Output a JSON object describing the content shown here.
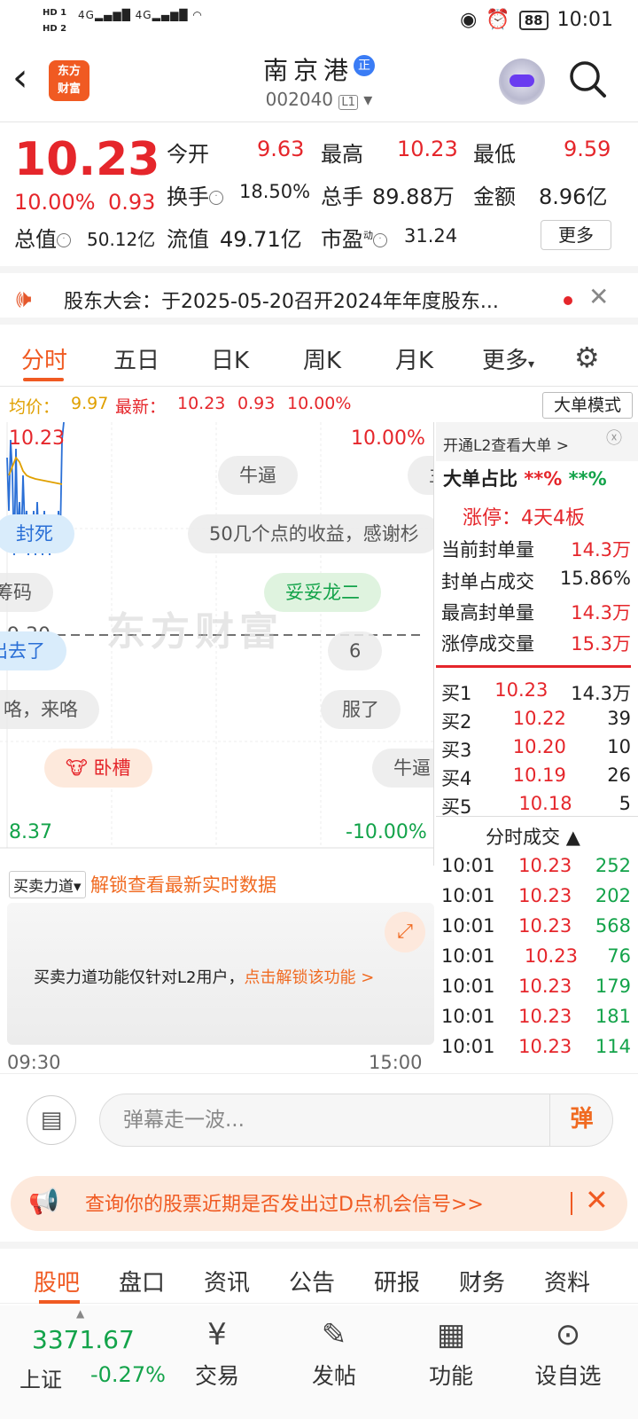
{
  "status_bar": {
    "hd1": "HD 1",
    "hd2": "HD 2",
    "net1": "4G",
    "net2": "4G",
    "battery": "88",
    "time": "10:01"
  },
  "header": {
    "logo_line1": "东方",
    "logo_line2": "财富",
    "stock_name": "南京港",
    "stock_badge": "正",
    "stock_code": "002040",
    "level": "L1"
  },
  "quote": {
    "price": "10.23",
    "change_pct": "10.00%",
    "change_amt": "0.93",
    "open_label": "今开",
    "open": "9.63",
    "high_label": "最高",
    "high": "10.23",
    "low_label": "最低",
    "low": "9.59",
    "turnover_label": "换手",
    "turnover": "18.50%",
    "volume_label": "总手",
    "volume": "89.88万",
    "amount_label": "金额",
    "amount": "8.96亿",
    "total_cap_label": "总值",
    "total_cap": "50.12亿",
    "float_cap_label": "流值",
    "float_cap": "49.71亿",
    "pe_label": "市盈",
    "pe_sup": "动",
    "pe": "31.24",
    "more": "更多"
  },
  "notice": {
    "text": "股东大会：于2025-05-20召开2024年年度股东..."
  },
  "tabs": [
    "分时",
    "五日",
    "日K",
    "周K",
    "月K",
    "更多"
  ],
  "chart_head": {
    "avg_label": "均价：",
    "avg": "9.97",
    "latest_label": "最新：",
    "latest": "10.23",
    "chg": "0.93",
    "pct": "10.00%",
    "mode_btn": "大单模式"
  },
  "chart": {
    "top_price": "10.23",
    "top_pct": "10.00%",
    "mid_price": "9.30",
    "bottom_price": "8.37",
    "bottom_pct": "-10.00%",
    "watermark": "东方财富"
  },
  "danmu": [
    "牛逼",
    "50几个点的收益，感谢杉",
    "封死",
    "筹码",
    "妥妥龙二",
    "出去了",
    "6",
    "咯，来咯",
    "服了",
    "卧槽",
    "牛逼"
  ],
  "side": {
    "l2_link": "开通L2查看大单 >",
    "big_ratio_label": "大单占比",
    "big_ratio_red": "**%",
    "big_ratio_green": "**%",
    "limit_up": "涨停：4天4板",
    "rows": [
      {
        "label": "当前封单量",
        "value": "14.3万"
      },
      {
        "label": "封单占成交",
        "value": "15.86%"
      },
      {
        "label": "最高封单量",
        "value": "14.3万"
      },
      {
        "label": "涨停成交量",
        "value": "15.3万"
      }
    ],
    "bids": [
      {
        "label": "买1",
        "price": "10.23",
        "vol": "14.3万"
      },
      {
        "label": "买2",
        "price": "10.22",
        "vol": "39"
      },
      {
        "label": "买3",
        "price": "10.20",
        "vol": "10"
      },
      {
        "label": "买4",
        "price": "10.19",
        "vol": "26"
      },
      {
        "label": "买5",
        "price": "10.18",
        "vol": "5"
      }
    ],
    "ticks_title": "分时成交",
    "ticks": [
      {
        "time": "10:01",
        "price": "10.23",
        "vol": "252"
      },
      {
        "time": "10:01",
        "price": "10.23",
        "vol": "202"
      },
      {
        "time": "10:01",
        "price": "10.23",
        "vol": "568"
      },
      {
        "time": "10:01",
        "price": "10.23",
        "vol": "76"
      },
      {
        "time": "10:01",
        "price": "10.23",
        "vol": "179"
      },
      {
        "time": "10:01",
        "price": "10.23",
        "vol": "181"
      },
      {
        "time": "10:01",
        "price": "10.23",
        "vol": "114"
      }
    ]
  },
  "power": {
    "selector": "买卖力道",
    "link": "解锁查看最新实时数据",
    "msg": "买卖力道功能仅针对L2用户，",
    "msg_link": "点击解锁该功能 >",
    "time_start": "09:30",
    "time_end": "15:00"
  },
  "input": {
    "placeholder": "弹幕走一波...",
    "send": "弹"
  },
  "promo": {
    "text": "查询你的股票近期是否发出过D点机会信号>>"
  },
  "bottom_tabs": [
    "股吧",
    "盘口",
    "资讯",
    "公告",
    "研报",
    "财务",
    "资料"
  ],
  "nav": {
    "index_value": "3371.67",
    "index_name": "上证",
    "index_chg": "-0.27%",
    "items": [
      "交易",
      "发帖",
      "功能",
      "设自选"
    ]
  }
}
